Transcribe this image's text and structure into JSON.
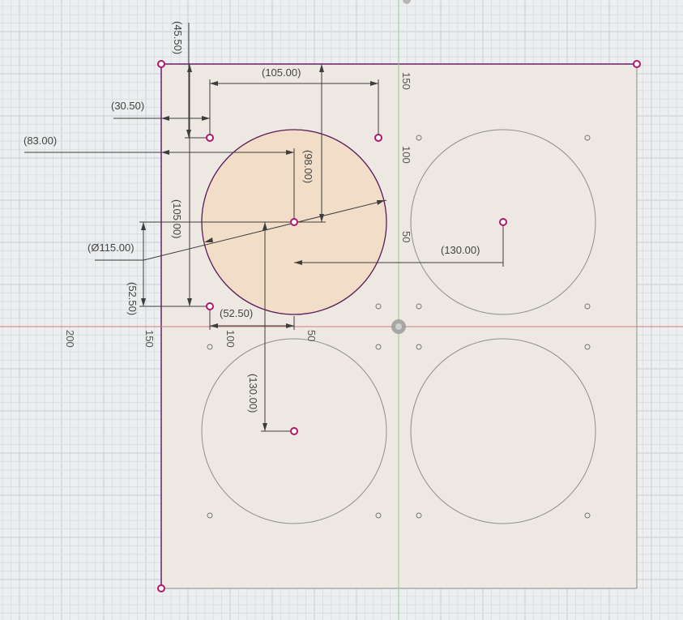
{
  "sketch": {
    "colors": {
      "background": "#eceeef",
      "grid_minor": "#dcdfe1",
      "grid_major": "#c9cdd0",
      "sheet_fill": "#ede8e2",
      "sheet_edge": "#6b1e6b",
      "sheet_edge_gray": "#8a8a8a",
      "selected_fill": "#f2dcc3",
      "selected_stroke": "#5a1a5a",
      "circle_stroke": "#8f8f8f",
      "point": "#b0166e",
      "dimension": "#3d3d3d",
      "axis_x": "#d27b7b",
      "axis_y": "#8fd08f"
    },
    "axis_labels": {
      "x_50": "50",
      "x_100": "100",
      "x_150": "150",
      "x_200": "200",
      "y_50": "50",
      "y_100": "100",
      "y_150": "150"
    },
    "dimensions": {
      "top_offset": "(45.50)",
      "width_between_holes": "(105.00)",
      "left_offset": "(30.50)",
      "center_x": "(83.00)",
      "vertical_to_center": "(98.00)",
      "height_between_holes": "(105.00)",
      "diameter": "(Ø115.00)",
      "center_spacing_x": "(130.00)",
      "hole_to_center_y": "(52.50)",
      "hole_to_center_x": "(52.50)",
      "center_spacing_y": "(130.00)"
    }
  }
}
